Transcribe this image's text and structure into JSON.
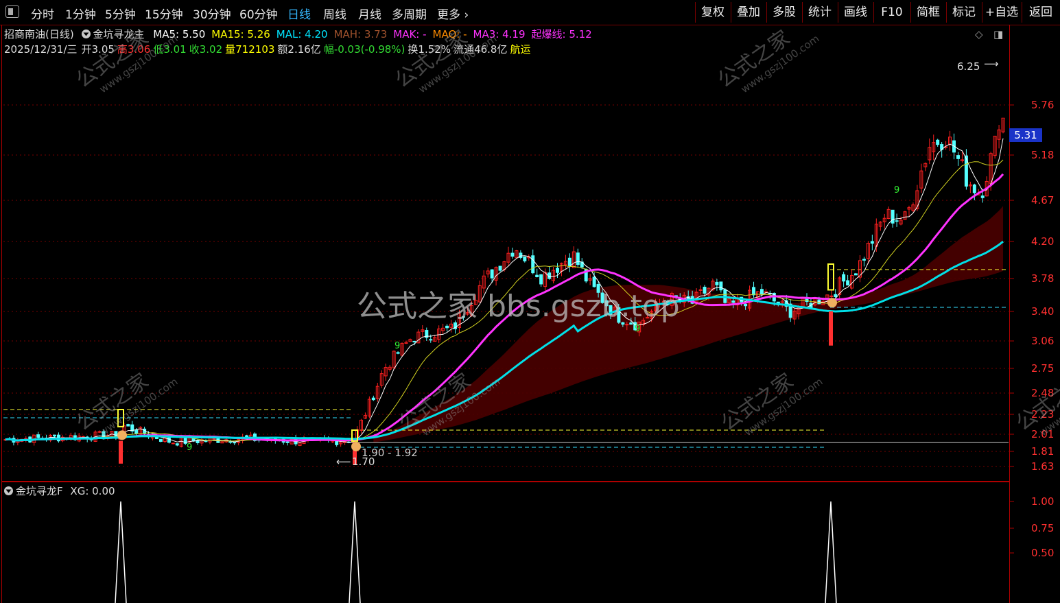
{
  "toolbar": {
    "left_items": [
      "分时",
      "1分钟",
      "5分钟",
      "15分钟",
      "30分钟",
      "60分钟",
      "日线",
      "周线",
      "月线",
      "多周期",
      "更多"
    ],
    "active": "日线",
    "right_items": [
      "复权",
      "叠加",
      "多股",
      "统计",
      "画线",
      "F10",
      "简框",
      "标记",
      "+自选",
      "返回"
    ]
  },
  "header": {
    "stock": "招商南油(日线)",
    "indicator": "金坑寻龙主",
    "ma": [
      {
        "label": "MA5: 5.50",
        "color": "#ffffff"
      },
      {
        "label": "MA15: 5.26",
        "color": "#ffff00"
      },
      {
        "label": "MAL: 4.20",
        "color": "#00e5ff"
      },
      {
        "label": "MAH: 3.73",
        "color": "#a0522d"
      },
      {
        "label": "MAK: -",
        "color": "#ff33ff"
      },
      {
        "label": "MAQ: -",
        "color": "#ff8c00"
      },
      {
        "label": "MA3: 4.19",
        "color": "#ff33ff"
      },
      {
        "label": "起爆线: 5.12",
        "color": "#ff33ff"
      }
    ],
    "quote": [
      {
        "label": "2025/12/31/三",
        "color": "#dddddd"
      },
      {
        "label": "开3.05",
        "color": "#dddddd"
      },
      {
        "label": "高3.06",
        "color": "#ff3333"
      },
      {
        "label": "低3.01",
        "color": "#33dd33"
      },
      {
        "label": "收3.02",
        "color": "#33dd33"
      },
      {
        "label": "量712103",
        "color": "#ffff00"
      },
      {
        "label": "额2.16亿",
        "color": "#dddddd"
      },
      {
        "label": "幅-0.03(-0.98%)",
        "color": "#33dd33"
      },
      {
        "label": "换1.52%",
        "color": "#dddddd"
      },
      {
        "label": "流通46.8亿",
        "color": "#dddddd"
      },
      {
        "label": "航运",
        "color": "#ffff00"
      }
    ]
  },
  "price_axis": [
    "5.76",
    "5.18",
    "4.67",
    "4.20",
    "3.78",
    "3.40",
    "3.06",
    "2.75",
    "2.48",
    "2.23",
    "2.01",
    "1.81",
    "1.63"
  ],
  "current_price": "5.31",
  "annotations": {
    "high": "6.25",
    "low": "1.70",
    "range": "1.90 - 1.92",
    "watermark_center": "公式之家 bbs.gszb.top",
    "watermark_tile_cn": "公式之家",
    "watermark_tile_url": "www.gszj100.com",
    "nine_marks": [
      "9",
      "9",
      "9",
      "9"
    ]
  },
  "sub": {
    "title": "金坑寻龙F",
    "xg": "XG: 0.00",
    "axis": [
      "1.00",
      "0.75",
      "0.50"
    ]
  },
  "colors": {
    "up": "#ff2020",
    "down": "#54ffff",
    "ma5": "#ffffff",
    "ma15": "#d0d020",
    "mal": "#00e0e8",
    "ma3": "#ff33ff",
    "fill": "#4a0000",
    "frame": "#b00000"
  }
}
